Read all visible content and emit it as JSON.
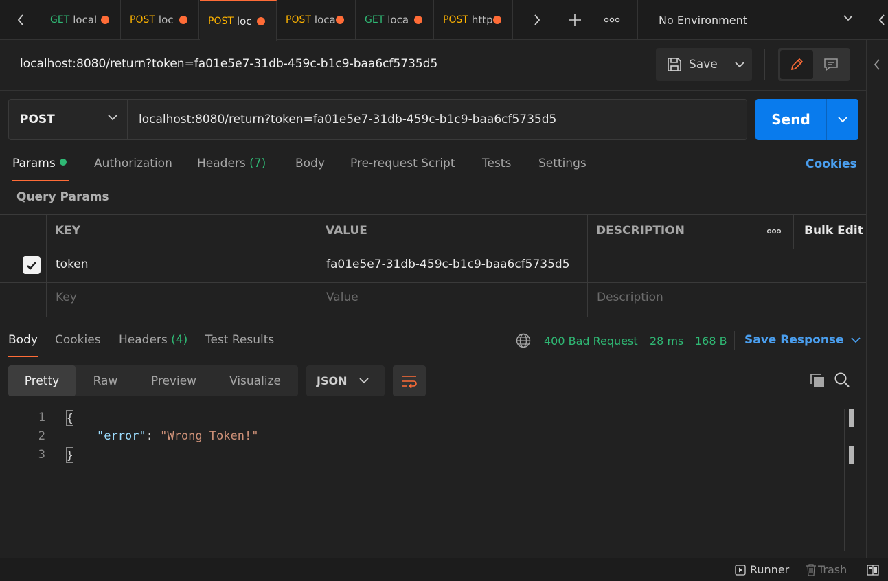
{
  "tabs": [
    {
      "method": "GET",
      "title": "local",
      "unsaved": true,
      "active": false
    },
    {
      "method": "POST",
      "title": "loc",
      "unsaved": true,
      "active": false
    },
    {
      "method": "POST",
      "title": "loc",
      "unsaved": true,
      "active": true
    },
    {
      "method": "POST",
      "title": "loca",
      "unsaved": true,
      "active": false
    },
    {
      "method": "GET",
      "title": "loca",
      "unsaved": true,
      "active": false
    },
    {
      "method": "POST",
      "title": "http",
      "unsaved": true,
      "active": false
    }
  ],
  "environment": {
    "selected": "No Environment"
  },
  "request": {
    "title": "localhost:8080/return?token=fa01e5e7-31db-459c-b1c9-baa6cf5735d5",
    "method": "POST",
    "url": "localhost:8080/return?token=fa01e5e7-31db-459c-b1c9-baa6cf5735d5",
    "save_label": "Save",
    "send_label": "Send"
  },
  "request_tabs": {
    "params": "Params",
    "authorization": "Authorization",
    "headers": "Headers",
    "headers_count": "(7)",
    "body": "Body",
    "prerequest": "Pre-request Script",
    "tests": "Tests",
    "settings": "Settings",
    "cookies": "Cookies"
  },
  "query_params": {
    "title": "Query Params",
    "columns": {
      "key": "KEY",
      "value": "VALUE",
      "description": "DESCRIPTION",
      "more": "ooo",
      "bulk_edit": "Bulk Edit"
    },
    "rows": [
      {
        "checked": true,
        "key": "token",
        "value": "fa01e5e7-31db-459c-b1c9-baa6cf5735d5",
        "description": ""
      }
    ],
    "placeholders": {
      "key": "Key",
      "value": "Value",
      "description": "Description"
    }
  },
  "response": {
    "tabs": {
      "body": "Body",
      "cookies": "Cookies",
      "headers": "Headers",
      "headers_count": "(4)",
      "test_results": "Test Results"
    },
    "status": "400 Bad Request",
    "time": "28 ms",
    "size": "168 B",
    "save_response": "Save Response",
    "view_modes": [
      "Pretty",
      "Raw",
      "Preview",
      "Visualize"
    ],
    "active_view": "Pretty",
    "format": "JSON",
    "lines": [
      "1",
      "2",
      "3"
    ],
    "open_brace": "{",
    "close_brace": "}",
    "json_key": "\"error\"",
    "json_colon": ": ",
    "json_value": "\"Wrong Token!\""
  },
  "footer": {
    "runner": "Runner",
    "trash": "Trash"
  },
  "colors": {
    "accent": "#ff6c37",
    "send": "#097bed",
    "get": "#2fb874",
    "post": "#ffb400",
    "link": "#4a9eee",
    "status_ok": "#2fb874"
  }
}
